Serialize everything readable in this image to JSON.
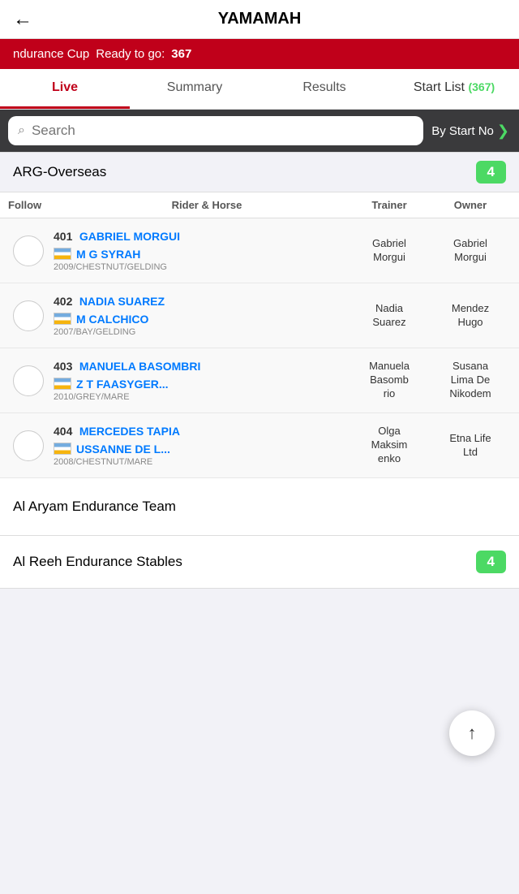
{
  "header": {
    "back_label": "←",
    "title": "YAMAMAH"
  },
  "banner": {
    "event": "ndurance Cup",
    "ready_label": "Ready to go:",
    "count": "367"
  },
  "tabs": [
    {
      "id": "live",
      "label": "Live",
      "active": true
    },
    {
      "id": "summary",
      "label": "Summary",
      "active": false
    },
    {
      "id": "results",
      "label": "Results",
      "active": false
    },
    {
      "id": "start-list",
      "label": "Start List",
      "badge": "(367)",
      "active": false
    }
  ],
  "search": {
    "placeholder": "Search",
    "by_start_label": "By Start No"
  },
  "groups": [
    {
      "name": "ARG-Overseas",
      "count": "4",
      "entries": [
        {
          "number": "401",
          "rider": "GABRIEL MORGUI",
          "horse": "M G SYRAH",
          "horse_details": "2009/CHESTNUT/GELDING",
          "trainer": "Gabriel\nMorgui",
          "owner": "Gabriel\nMorgui"
        },
        {
          "number": "402",
          "rider": "NADIA SUAREZ",
          "horse": "M CALCHICO",
          "horse_details": "2007/BAY/GELDING",
          "trainer": "Nadia\nSuarez",
          "owner": "Mendez\nHugo"
        },
        {
          "number": "403",
          "rider": "MANUELA BASOMBRI",
          "horse": "Z T FAASYGER...",
          "horse_details": "2010/GREY/MARE",
          "trainer": "Manuela\nBasombrio",
          "owner": "Susana\nLima De\nNikodem"
        },
        {
          "number": "404",
          "rider": "MERCEDES TAPIA",
          "horse": "USSANNE DE L...",
          "horse_details": "2008/CHESTNUT/MARE",
          "trainer": "Olga\nMaksimenko",
          "owner": "Etna Life\nLtd"
        }
      ]
    }
  ],
  "extra_groups": [
    {
      "name": "Al Aryam Endurance Team",
      "count": null
    },
    {
      "name": "Al Reeh Endurance Stables",
      "count": "4"
    }
  ],
  "table_headers": {
    "follow": "Follow",
    "rider_horse": "Rider & Horse",
    "trainer": "Trainer",
    "owner": "Owner"
  }
}
